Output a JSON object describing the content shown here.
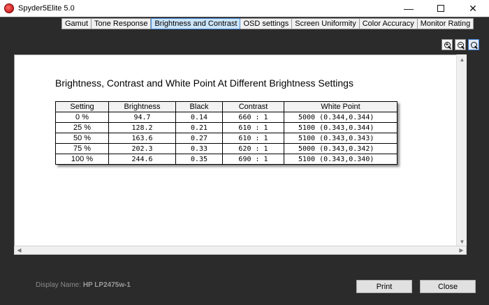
{
  "window": {
    "title": "Spyder5Elite 5.0",
    "minimize_glyph": "—",
    "close_glyph": "✕"
  },
  "tabs": [
    {
      "label": "Gamut",
      "active": false
    },
    {
      "label": "Tone Response",
      "active": false
    },
    {
      "label": "Brightness and Contrast",
      "active": true
    },
    {
      "label": "OSD settings",
      "active": false
    },
    {
      "label": "Screen Uniformity",
      "active": false
    },
    {
      "label": "Color Accuracy",
      "active": false
    },
    {
      "label": "Monitor Rating",
      "active": false
    }
  ],
  "zoom": {
    "zoom_in_glyph": "+",
    "zoom_out_glyph": "−",
    "zoom_fit_glyph": ""
  },
  "report": {
    "title": "Brightness, Contrast and White Point At Different Brightness Settings",
    "columns": [
      "Setting",
      "Brightness",
      "Black",
      "Contrast",
      "White Point"
    ],
    "rows": [
      {
        "setting": "0 %",
        "brightness": "94.7",
        "black": "0.14",
        "contrast": "660 : 1",
        "white_point": "5000 (0.344,0.344)"
      },
      {
        "setting": "25 %",
        "brightness": "128.2",
        "black": "0.21",
        "contrast": "610 : 1",
        "white_point": "5100 (0.343,0.344)"
      },
      {
        "setting": "50 %",
        "brightness": "163.6",
        "black": "0.27",
        "contrast": "610 : 1",
        "white_point": "5100 (0.343,0.343)"
      },
      {
        "setting": "75 %",
        "brightness": "202.3",
        "black": "0.33",
        "contrast": "620 : 1",
        "white_point": "5000 (0.343,0.342)"
      },
      {
        "setting": "100 %",
        "brightness": "244.6",
        "black": "0.35",
        "contrast": "690 : 1",
        "white_point": "5100 (0.343,0.340)"
      }
    ]
  },
  "footer": {
    "display_name_label": "Display Name:",
    "display_name_value": "HP LP2475w-1",
    "print_label": "Print",
    "close_label": "Close"
  },
  "colors": {
    "frame": "#2b2b2b",
    "active_tab": "#cce4f7",
    "button_bg": "#e1e1e1"
  }
}
